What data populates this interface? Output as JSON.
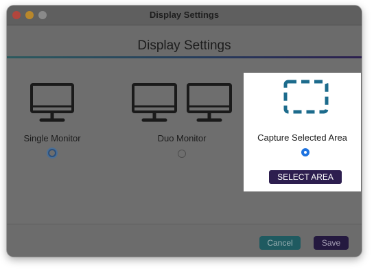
{
  "window": {
    "title": "Display Settings"
  },
  "header": {
    "title": "Display Settings"
  },
  "options": [
    {
      "label": "Single Monitor",
      "icon": "monitor-icon",
      "state": "focused"
    },
    {
      "label": "Duo Monitor",
      "icon": "dual-monitor-icon",
      "state": "unselected"
    },
    {
      "label": "Capture Selected Area",
      "icon": "selection-area-icon",
      "state": "selected"
    }
  ],
  "select_area_button": "SELECT AREA",
  "footer": {
    "cancel_label": "Cancel",
    "save_label": "Save"
  },
  "colors": {
    "accent_teal": "#1f5a60",
    "accent_purple": "#2d1e4f",
    "radio_selected": "#1e73e0",
    "selection_icon": "#1c6b8c"
  }
}
